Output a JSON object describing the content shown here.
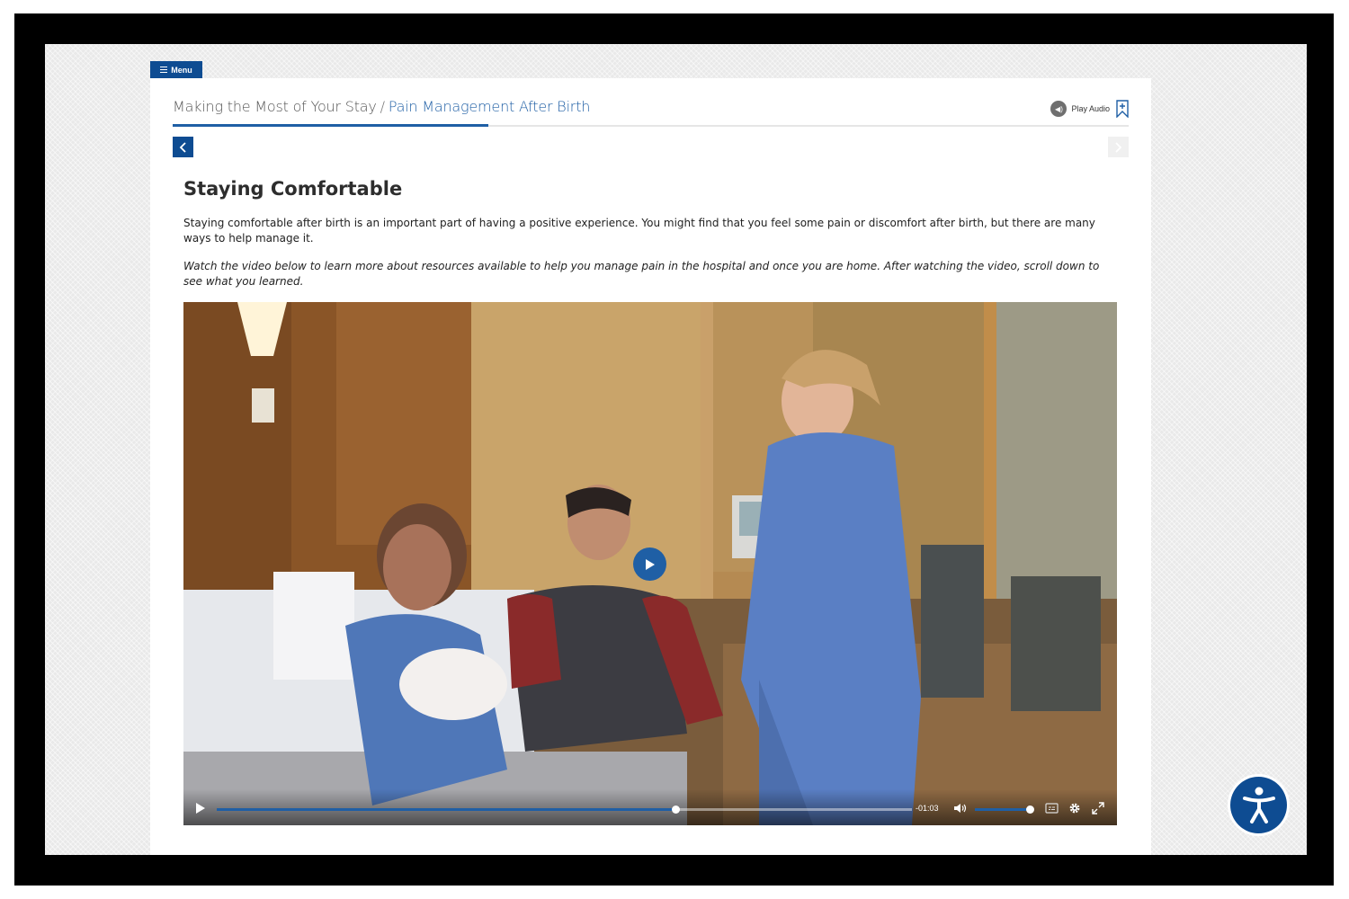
{
  "menu": {
    "label": "Menu",
    "icon": "hamburger-icon"
  },
  "breadcrumb": {
    "parent": "Making the Most of Your Stay",
    "separator": "/",
    "current": "Pain Management After Birth"
  },
  "progress": {
    "value": 0.33
  },
  "audio": {
    "label": "Play Audio",
    "icon": "audio-icon",
    "bookmark_icon": "bookmark-add-icon"
  },
  "nav": {
    "prev_icon": "chevron-left-icon",
    "next_icon": "chevron-right-icon"
  },
  "content": {
    "heading": "Staying Comfortable",
    "paragraph": "Staying comfortable after birth is an important part of having a positive experience. You might find that you feel some pain or discomfort after birth, but there are many ways to help manage it.",
    "instruction": "Watch the video below to learn more about resources available to help you manage pain in the hospital and once you are home. After watching the video, scroll down to see what you learned."
  },
  "video": {
    "poster_icon": "play-icon",
    "time_remaining": "-01:03",
    "progress": 0.66,
    "volume": 0.98,
    "controls": [
      "play-icon",
      "volume-icon",
      "captions-icon",
      "gear-icon",
      "fullscreen-icon"
    ]
  },
  "accessibility": {
    "icon": "accessibility-icon"
  },
  "colors": {
    "brand_blue": "#0e4c92",
    "accent_blue": "#1f5fa5",
    "frame": "#000000",
    "background": "#e9e9e9"
  }
}
